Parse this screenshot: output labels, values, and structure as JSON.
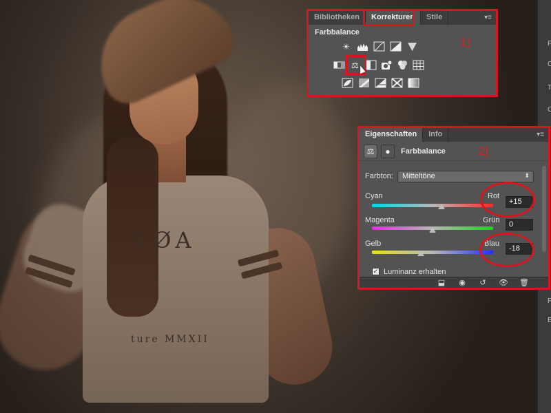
{
  "korrekturen_panel": {
    "tabs": [
      {
        "label": "Bibliotheken",
        "active": false
      },
      {
        "label": "Korrekturen",
        "active": true
      },
      {
        "label": "Stile",
        "active": false
      }
    ],
    "menu_icon": "panel-menu-icon",
    "heading": "Farbbalance",
    "annotation": "1)",
    "icon_rows": [
      [
        "brightness-contrast-icon",
        "levels-icon",
        "curves-icon",
        "exposure-icon",
        "vibrance-icon"
      ],
      [
        "hue-saturation-icon",
        "color-balance-icon",
        "black-white-icon",
        "photo-filter-icon",
        "channel-mixer-icon",
        "color-lookup-icon"
      ],
      [
        "invert-icon",
        "posterize-icon",
        "threshold-icon",
        "selective-color-icon",
        "gradient-map-icon"
      ]
    ]
  },
  "eigenschaften_panel": {
    "tabs": [
      {
        "label": "Eigenschaften",
        "active": true
      },
      {
        "label": "Info",
        "active": false
      }
    ],
    "title": "Farbbalance",
    "annotation": "2)",
    "farbton_label": "Farbton:",
    "farbton_value": "Mitteltöne",
    "sliders": [
      {
        "left": "Cyan",
        "right": "Rot",
        "value": "+15",
        "position": 0.57
      },
      {
        "left": "Magenta",
        "right": "Grün",
        "value": "0",
        "position": 0.5
      },
      {
        "left": "Gelb",
        "right": "Blau",
        "value": "-18",
        "position": 0.41
      }
    ],
    "checkbox_label": "Luminanz erhalten",
    "checkbox_checked": true,
    "footer_icons": [
      "clip-to-layer-icon",
      "view-previous-state-icon",
      "reset-icon",
      "visibility-icon",
      "trash-icon"
    ]
  },
  "photo": {
    "shirt_text_top": "LØA",
    "shirt_text_bottom": "ture MMXII"
  },
  "colors": {
    "annotation_red": "#d8161f",
    "panel_bg": "#535353",
    "tab_bar": "#3d3d3d"
  }
}
